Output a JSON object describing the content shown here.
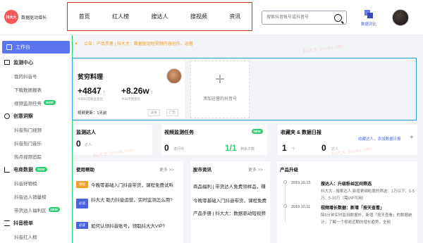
{
  "header": {
    "logo_text": "抖大大",
    "brand": "数据驱动增长",
    "nav": [
      "首页",
      "红人榜",
      "搜达人",
      "搜视频",
      "资讯"
    ],
    "search_placeholder": "搜索抖音帐号或抖音号",
    "compare_label": "数据对比"
  },
  "sidebar": {
    "items": [
      {
        "label": "工作台",
        "type": "active"
      },
      {
        "label": "监测中心",
        "type": "group"
      },
      {
        "label": "我的抖音号",
        "type": "sub"
      },
      {
        "label": "下载数据报表",
        "type": "sub"
      },
      {
        "label": "视频监测任务",
        "type": "sub",
        "badge": "NEW"
      },
      {
        "label": "创意洞察",
        "type": "group"
      },
      {
        "label": "抖音热门视频",
        "type": "sub"
      },
      {
        "label": "抖音热门音乐",
        "type": "sub"
      },
      {
        "label": "热点视频追踪",
        "type": "sub"
      },
      {
        "label": "电商数据",
        "type": "group",
        "badge": "NEW"
      },
      {
        "label": "抖音好物榜",
        "type": "sub"
      },
      {
        "label": "抖音达人销量榜",
        "type": "sub"
      },
      {
        "label": "带货达人福利区",
        "type": "sub",
        "badge": "NEW"
      },
      {
        "label": "抖音榜单",
        "type": "group"
      },
      {
        "label": "抖音红人榜",
        "type": "sub"
      }
    ]
  },
  "notice": {
    "prefix": "公告：",
    "text": "产品手册 | 抖大大：数据驱动短视频内容创作、运营"
  },
  "account": {
    "name": "贫穷料理",
    "fans_delta": "+4847",
    "fans_label": "今日抖音粉丝变化",
    "likes_delta": "+8.26w",
    "likes_label": "今日点赞变化",
    "update": "视频更新：1天前",
    "tags": [
      "美食",
      "广告"
    ],
    "add_label": "添加运营的抖音号"
  },
  "monitor_creator": {
    "title": "监测达人",
    "value": "0",
    "unit": "达人"
  },
  "video_task": {
    "title": "视频监测任务",
    "badge": "NEW",
    "running": "0",
    "running_unit": "进行中",
    "remaining": "1/1",
    "remaining_unit": "剩余次数"
  },
  "favorites": {
    "title": "收藏夹 & 数据日报",
    "link": "收藏达人，添加数据日报",
    "items_value": "1",
    "items_unit": "个",
    "creator_value": "0",
    "creator_unit": "达人"
  },
  "help": {
    "title": "使用帮助",
    "more": "更多 >>",
    "rows": [
      {
        "tag": "课程",
        "color": "orange",
        "text": "今晚零基础入门抖音带货，课程免费试听"
      },
      {
        "tag": "必读",
        "color": "blue",
        "text": "抖大大 助力抖音运营，实时监测怎么用?"
      },
      {
        "tag": "必读",
        "color": "blue",
        "text": "如何认领抖音账号，领取抖大大VIP?"
      }
    ]
  },
  "news": {
    "title": "股市资讯",
    "more": "更多 >>",
    "rows": [
      "商品福利 | 带货达人免费领样品，赚",
      "今晚零基础入门抖音带货，课程免费",
      "产品手册 | 抖大大：数据驱动短视频"
    ]
  },
  "upgrades": {
    "title": "产品升级",
    "items": [
      {
        "date": "2019.10.15",
        "head": "搜达人：升级粉丝区间筛选",
        "text": "抖大大 - 搜索达人 新增更细粒度的筛选：1万以下、1-5万、5-10万（需VIP可用）"
      },
      {
        "date": "2019.10.11",
        "head": "视频增长数据：新增「按天查看」",
        "text": "除5分钟实时监测数据外，新增「按天查看」的数据统计，了解一个视频近期的增长趋势，全网"
      }
    ]
  },
  "watermark": "抖大大 douda.com"
}
